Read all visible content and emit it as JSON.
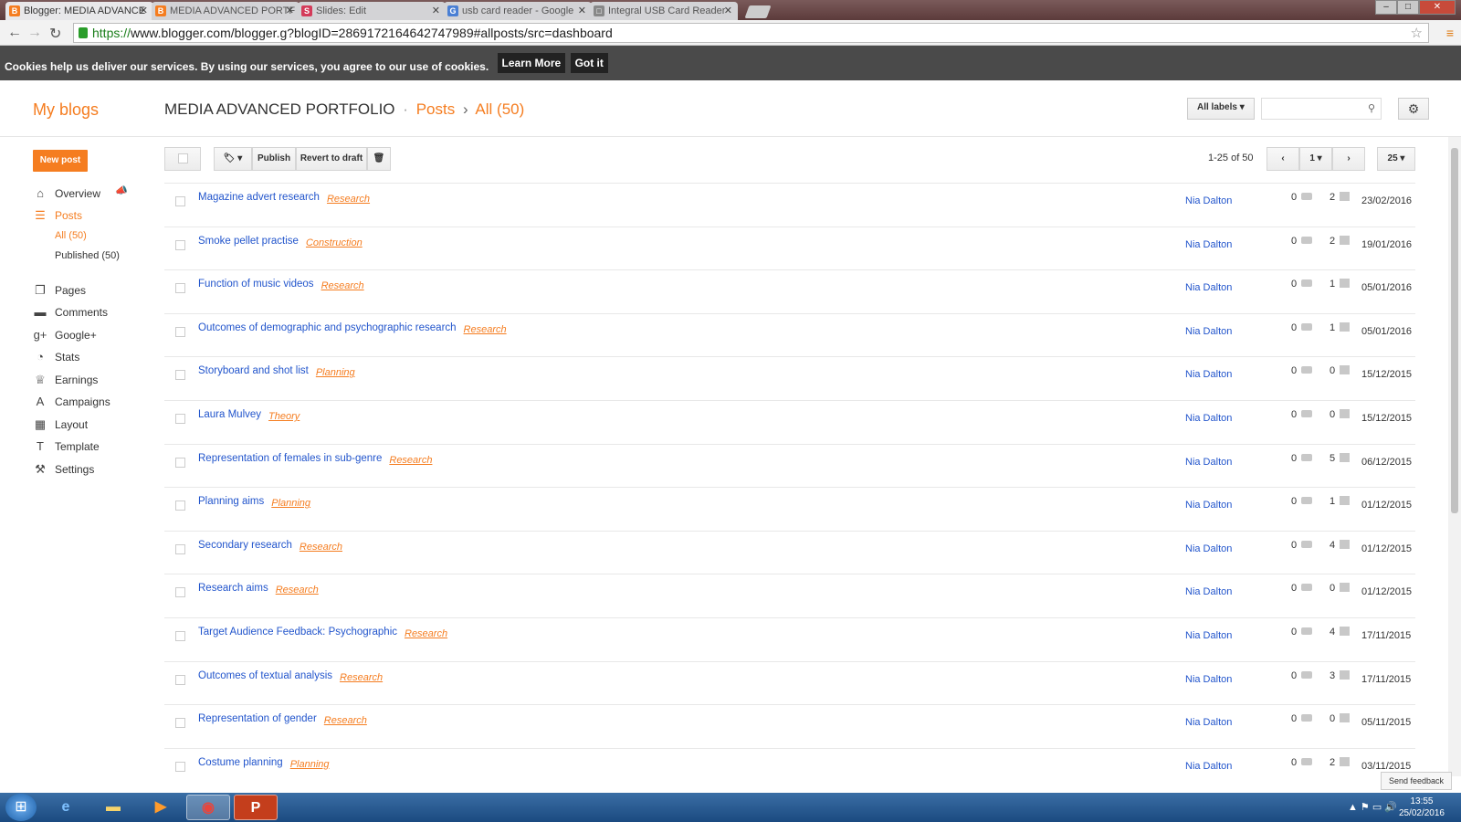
{
  "browser": {
    "tabs": [
      {
        "title": "Blogger: MEDIA ADVANCE",
        "icon": "B",
        "color": "#f57d20",
        "active": true
      },
      {
        "title": "MEDIA ADVANCED PORTF",
        "icon": "B",
        "color": "#f57d20",
        "active": false
      },
      {
        "title": "Slides: Edit",
        "icon": "S",
        "color": "#d43b5a",
        "active": false
      },
      {
        "title": "usb card reader - Google",
        "icon": "G",
        "color": "#4a7fd4",
        "active": false
      },
      {
        "title": "Integral USB Card Reader",
        "icon": "□",
        "color": "#888888",
        "active": false
      }
    ],
    "url_scheme": "https://",
    "url_rest": "www.blogger.com/blogger.g?blogID=2869172164642747989#allposts/src=dashboard"
  },
  "cookie": {
    "message": "Cookies help us deliver our services. By using our services, you agree to our use of cookies.",
    "learn_more": "Learn More",
    "got_it": "Got it"
  },
  "header": {
    "my_blogs": "My blogs",
    "blog_title": "MEDIA ADVANCED PORTFOLIO",
    "sep1": "·",
    "crumb_posts": "Posts",
    "sep2": "›",
    "crumb_all": "All (50)",
    "labels_button": "All labels"
  },
  "sidebar": {
    "new_post": "New post",
    "items": [
      {
        "label": "Overview",
        "icon": "⌂",
        "active": false
      },
      {
        "label": "Posts",
        "icon": "☰",
        "active": true
      },
      {
        "label": "Pages",
        "icon": "❐",
        "active": false
      },
      {
        "label": "Comments",
        "icon": "▬",
        "active": false
      },
      {
        "label": "Google+",
        "icon": "g+",
        "active": false
      },
      {
        "label": "Stats",
        "icon": "◔",
        "active": false
      },
      {
        "label": "Earnings",
        "icon": "♕",
        "active": false
      },
      {
        "label": "Campaigns",
        "icon": "A",
        "active": false
      },
      {
        "label": "Layout",
        "icon": "▦",
        "active": false
      },
      {
        "label": "Template",
        "icon": "T",
        "active": false
      },
      {
        "label": "Settings",
        "icon": "⚒",
        "active": false
      }
    ],
    "subitems": [
      {
        "label": "All (50)",
        "active": true
      },
      {
        "label": "Published (50)",
        "active": false
      }
    ]
  },
  "toolbar": {
    "publish": "Publish",
    "revert": "Revert to draft",
    "range": "1-25 of 50",
    "page": "1",
    "per_page": "25"
  },
  "posts": [
    {
      "title": "Magazine advert research",
      "label": "Research",
      "author": "Nia Dalton",
      "comments": "0",
      "views": "2",
      "date": "23/02/2016"
    },
    {
      "title": "Smoke pellet practise",
      "label": "Construction",
      "author": "Nia Dalton",
      "comments": "0",
      "views": "2",
      "date": "19/01/2016"
    },
    {
      "title": "Function of music videos",
      "label": "Research",
      "author": "Nia Dalton",
      "comments": "0",
      "views": "1",
      "date": "05/01/2016"
    },
    {
      "title": "Outcomes of demographic and psychographic research",
      "label": "Research",
      "author": "Nia Dalton",
      "comments": "0",
      "views": "1",
      "date": "05/01/2016"
    },
    {
      "title": "Storyboard and shot list",
      "label": "Planning",
      "author": "Nia Dalton",
      "comments": "0",
      "views": "0",
      "date": "15/12/2015"
    },
    {
      "title": "Laura Mulvey",
      "label": "Theory",
      "author": "Nia Dalton",
      "comments": "0",
      "views": "0",
      "date": "15/12/2015"
    },
    {
      "title": "Representation of females in sub-genre",
      "label": "Research",
      "author": "Nia Dalton",
      "comments": "0",
      "views": "5",
      "date": "06/12/2015"
    },
    {
      "title": "Planning aims",
      "label": "Planning",
      "author": "Nia Dalton",
      "comments": "0",
      "views": "1",
      "date": "01/12/2015"
    },
    {
      "title": "Secondary research",
      "label": "Research",
      "author": "Nia Dalton",
      "comments": "0",
      "views": "4",
      "date": "01/12/2015"
    },
    {
      "title": "Research aims",
      "label": "Research",
      "author": "Nia Dalton",
      "comments": "0",
      "views": "0",
      "date": "01/12/2015"
    },
    {
      "title": "Target Audience Feedback: Psychographic",
      "label": "Research",
      "author": "Nia Dalton",
      "comments": "0",
      "views": "4",
      "date": "17/11/2015"
    },
    {
      "title": "Outcomes of textual analysis",
      "label": "Research",
      "author": "Nia Dalton",
      "comments": "0",
      "views": "3",
      "date": "17/11/2015"
    },
    {
      "title": "Representation of gender",
      "label": "Research",
      "author": "Nia Dalton",
      "comments": "0",
      "views": "0",
      "date": "05/11/2015"
    },
    {
      "title": "Costume planning",
      "label": "Planning",
      "author": "Nia Dalton",
      "comments": "0",
      "views": "2",
      "date": "03/11/2015"
    }
  ],
  "feedback": "Send feedback",
  "taskbar": {
    "time": "13:55",
    "date": "25/02/2016"
  },
  "colors": {
    "accent": "#f57d20",
    "link": "#2255cc"
  }
}
